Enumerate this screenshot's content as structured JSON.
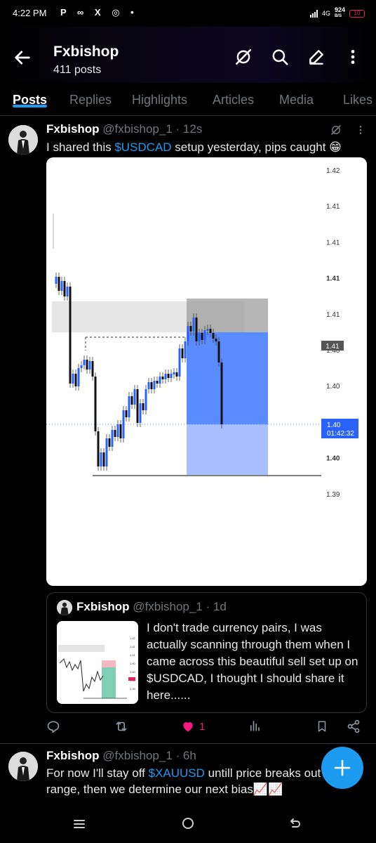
{
  "status_bar": {
    "time": "4:22 PM",
    "left_icons": "P ∞ X ◎ •",
    "network": "4G",
    "speed_value": "924",
    "speed_unit": "B/S",
    "battery": "10"
  },
  "header": {
    "title": "Fxbishop",
    "subtitle": "411 posts"
  },
  "tabs": [
    "Posts",
    "Replies",
    "Highlights",
    "Articles",
    "Media",
    "Likes"
  ],
  "post1": {
    "name": "Fxbishop",
    "handle": "@fxbishop_1",
    "time": "· 12s",
    "text_before": "I shared this ",
    "cashtag": "$USDCAD",
    "text_after": " setup yesterday, pips caught 😁"
  },
  "chart_data": {
    "type": "candlestick",
    "y_ticks": [
      "1.42",
      "1.41",
      "1.41",
      "1.41",
      "1.41",
      "1.40",
      "1.40",
      "1.40",
      "1.40",
      "1.39"
    ],
    "current_price_label": "1.41",
    "last_price_label": "1.40",
    "countdown_label": "01:42:32",
    "accent_color": "#2962ff"
  },
  "quote": {
    "name": "Fxbishop",
    "handle": "@fxbishop_1",
    "time": "· 1d",
    "text": "I don't trade currency pairs, I was actually scanning through them when I came across this beautiful sell set up on $USDCAD, I thought I should share it here......"
  },
  "actions": {
    "likes": "1",
    "like_color": "#f91880"
  },
  "post2": {
    "name": "Fxbishop",
    "handle": "@fxbishop_1",
    "time": "· 6h",
    "text_before": "For now I'll stay off ",
    "cashtag": "$XAUUSD",
    "text_after": " untill price breaks out of this range, then we determine our next bias📈📈"
  },
  "fab": {
    "label": "+"
  }
}
